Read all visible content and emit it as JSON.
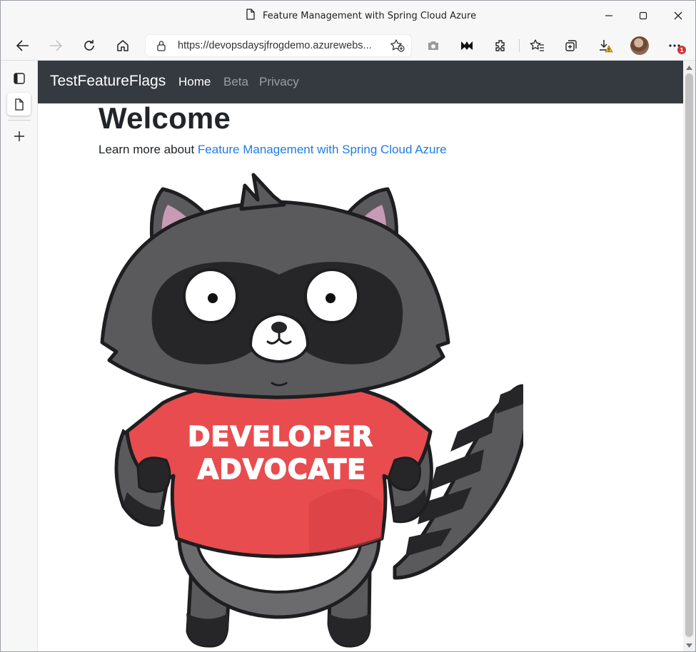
{
  "window": {
    "title": "Feature Management with Spring Cloud Azure"
  },
  "toolbar": {
    "url": "https://devopsdaysjfrogdemo.azurewebs...",
    "icons": [
      "back-icon",
      "forward-icon",
      "refresh-icon",
      "home-icon",
      "lock-icon",
      "add-favorite-icon",
      "screenshot-icon",
      "extension-m-icon",
      "extensions-icon",
      "favorites-icon",
      "collections-icon",
      "downloads-icon",
      "profile-avatar",
      "more-icon"
    ],
    "notification_badge": "1"
  },
  "sidebar": {
    "icons": [
      "tab-actions-icon",
      "page-tab-icon",
      "new-tab-icon"
    ]
  },
  "page": {
    "brand": "TestFeatureFlags",
    "nav": [
      {
        "label": "Home",
        "active": true
      },
      {
        "label": "Beta",
        "active": false
      },
      {
        "label": "Privacy",
        "active": false
      }
    ],
    "heading": "Welcome",
    "learn_prefix": "Learn more about ",
    "learn_link": "Feature Management with Spring Cloud Azure",
    "mascot": {
      "shirt_line1": "DEVELOPER",
      "shirt_line2": "ADVOCATE"
    }
  },
  "colors": {
    "navbar_bg": "#343a40",
    "link": "#1e7ce8",
    "shirt": "#e84c4f",
    "fur_dark": "#5a5a5c",
    "mask": "#262628"
  }
}
